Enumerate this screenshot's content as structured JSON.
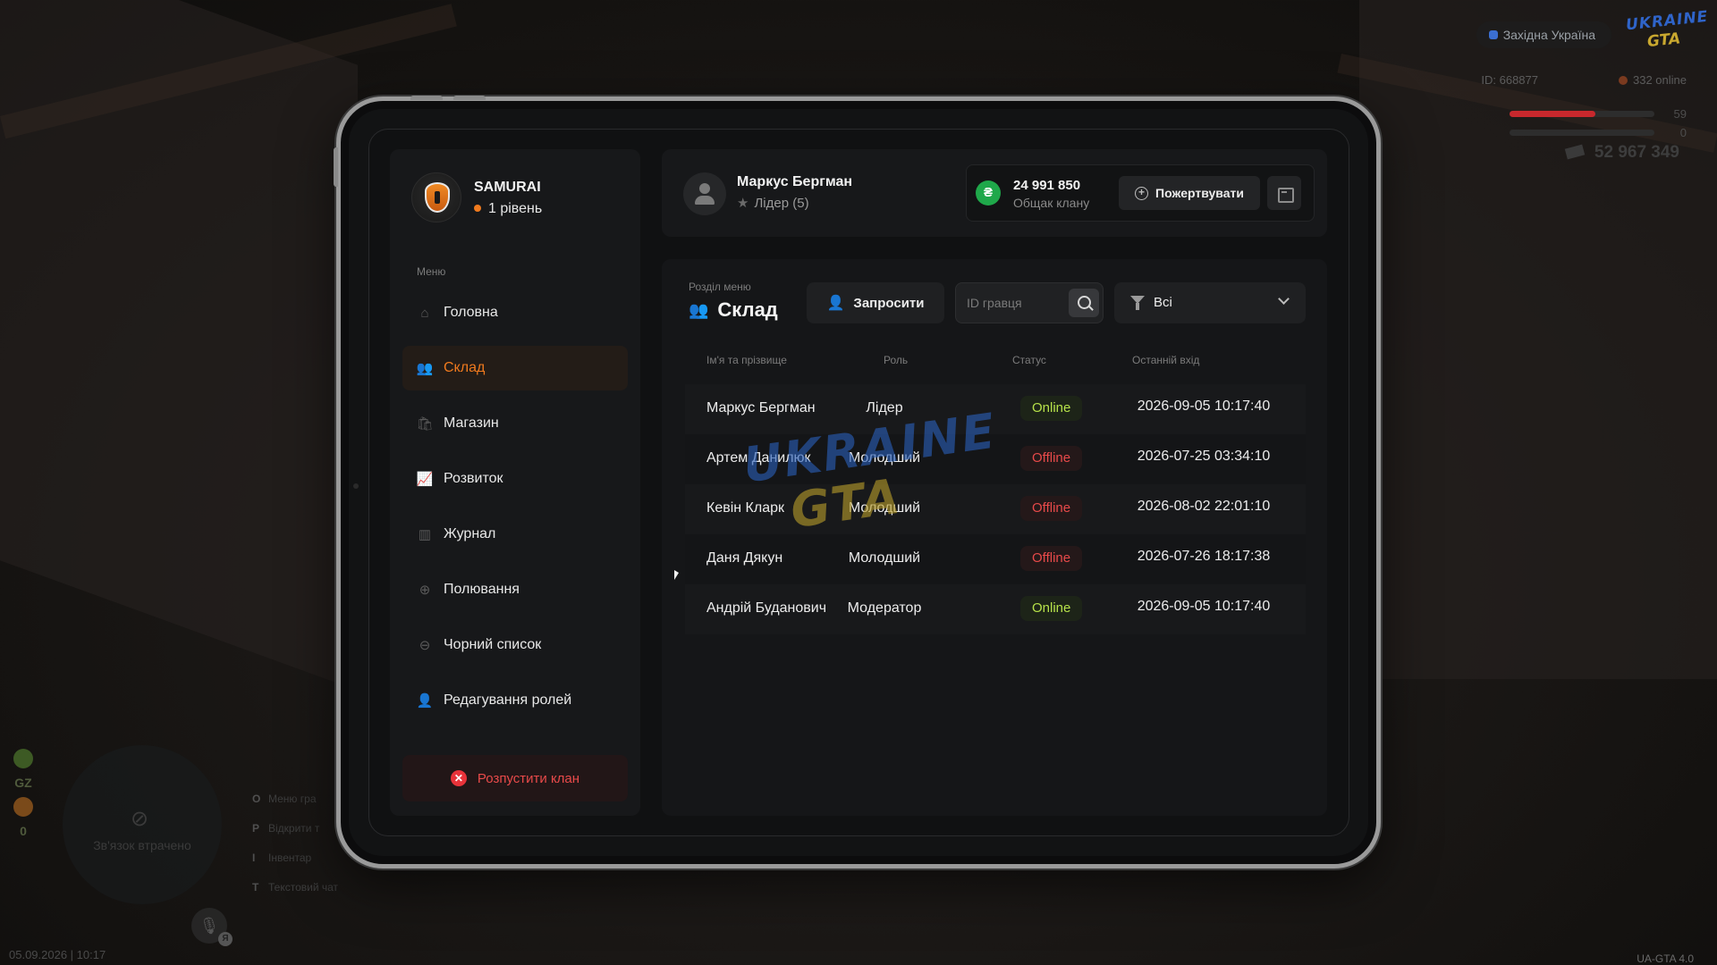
{
  "hud": {
    "region": "Західна Україна",
    "logo_line1": "UKRAINE",
    "logo_line2": "GTA",
    "player_id": "ID: 668877",
    "online": "332 online",
    "health": "59",
    "health_fraction": 0.59,
    "armor": "0",
    "armor_fraction": 0,
    "money": "52 967 349",
    "gz_label": "GZ",
    "gz_count": "0",
    "minimap_text": "Зв'язок втрачено",
    "mic_badge": "Я",
    "hints": [
      {
        "key": "O",
        "label": "Меню гра"
      },
      {
        "key": "P",
        "label": "Відкрити т"
      },
      {
        "key": "I",
        "label": "Інвентар"
      },
      {
        "key": "T",
        "label": "Текстовий чат"
      }
    ],
    "datetime": "05.09.2026 | 10:17",
    "version": "UA-GTA 4.0"
  },
  "clan": {
    "name": "SAMURAI",
    "level": "1 рівень"
  },
  "menu": {
    "caption": "Меню",
    "items": [
      {
        "label": "Головна",
        "icon": "home-icon",
        "glyph": "⌂",
        "active": false
      },
      {
        "label": "Склад",
        "icon": "team-icon",
        "glyph": "👥",
        "active": true
      },
      {
        "label": "Магазин",
        "icon": "shop-icon",
        "glyph": "🛍",
        "active": false
      },
      {
        "label": "Розвиток",
        "icon": "chart-icon",
        "glyph": "📈",
        "active": false
      },
      {
        "label": "Журнал",
        "icon": "book-icon",
        "glyph": "▥",
        "active": false
      },
      {
        "label": "Полювання",
        "icon": "crosshair-icon",
        "glyph": "⊕",
        "active": false
      },
      {
        "label": "Чорний список",
        "icon": "block-icon",
        "glyph": "⊖",
        "active": false
      },
      {
        "label": "Редагування ролей",
        "icon": "user-edit-icon",
        "glyph": "👤",
        "active": false
      }
    ],
    "disband_label": "Розпустити клан"
  },
  "header": {
    "user_name": "Маркус Бергман",
    "user_role": "Лідер (5)",
    "bank_amount": "24 991 850",
    "bank_label": "Общак клану",
    "bank_currency": "₴",
    "donate_label": "Пожертвувати"
  },
  "section": {
    "caption": "Розділ меню",
    "title": "Склад",
    "invite_label": "Запросити",
    "search_placeholder": "ID гравця",
    "filter_value": "Всі"
  },
  "table": {
    "headers": [
      "Ім'я та прізвище",
      "Роль",
      "Статус",
      "Останній вхід"
    ],
    "rows": [
      {
        "name": "Маркус Бергман",
        "role": "Лідер",
        "status": "Online",
        "last_login": "2026-09-05 10:17:40"
      },
      {
        "name": "Артем Данилюк",
        "role": "Молодший",
        "status": "Offline",
        "last_login": "2026-07-25 03:34:10"
      },
      {
        "name": "Кевін Кларк",
        "role": "Молодший",
        "status": "Offline",
        "last_login": "2026-08-02 22:01:10"
      },
      {
        "name": "Даня Дякун",
        "role": "Молодший",
        "status": "Offline",
        "last_login": "2026-07-26 18:17:38"
      },
      {
        "name": "Андрій Буданович",
        "role": "Модератор",
        "status": "Online",
        "last_login": "2026-09-05 10:17:40"
      }
    ]
  },
  "watermark": {
    "line1": "UKRAINE",
    "line2": "GTA"
  },
  "colors": {
    "accent": "#f07a1e",
    "online": "#b6e14a",
    "offline": "#e84a4a",
    "bank": "#1fa84a",
    "health": "#c8282d",
    "armor": "#3a3a3a"
  }
}
